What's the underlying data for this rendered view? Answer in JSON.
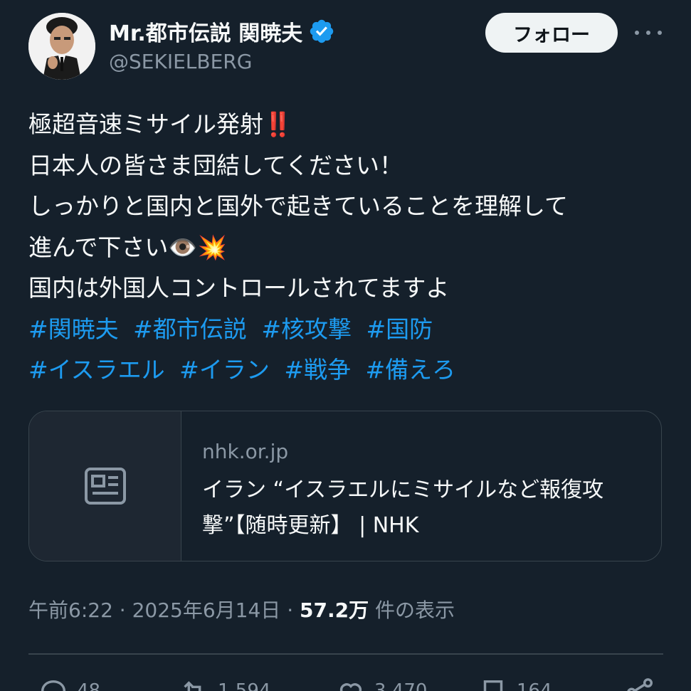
{
  "user": {
    "display_name": "Mr.都市伝説 関暁夫",
    "handle": "@SEKIELBERG",
    "verified": true
  },
  "header": {
    "follow_label": "フォロー"
  },
  "tweet": {
    "lines": [
      "極超音速ミサイル発射‼️",
      "日本人の皆さま団結してください！",
      "しっかりと国内と国外で起きていることを理解して",
      "進んで下さい👁️💥",
      "国内は外国人コントロールされてますよ"
    ],
    "hashtags_row1": [
      "#関暁夫",
      "#都市伝説",
      "#核攻撃",
      "#国防"
    ],
    "hashtags_row2": [
      "#イスラエル",
      "#イラン",
      "#戦争",
      "#備えろ"
    ]
  },
  "card": {
    "domain": "nhk.or.jp",
    "title": "イラン “イスラエルにミサイルなど報復攻撃”【随時更新】 | NHK"
  },
  "meta": {
    "time": "午前6:22",
    "date": "2025年6月14日",
    "views": "57.2万",
    "views_suffix": "件の表示"
  },
  "actions": {
    "replies": "48",
    "reposts": "1,594",
    "likes": "3,470",
    "bookmarks": "164"
  },
  "colors": {
    "background": "#15202b",
    "accent": "#1d9bf0",
    "text": "#f7f9f9",
    "muted": "#8b98a5",
    "border": "#38444d"
  }
}
